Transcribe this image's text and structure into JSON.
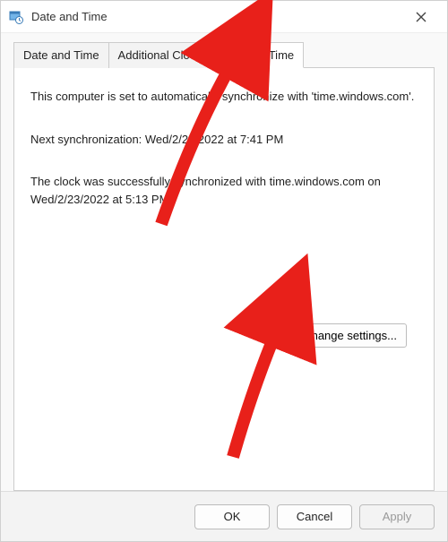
{
  "window": {
    "title": "Date and Time"
  },
  "tabs": {
    "0": {
      "label": "Date and Time"
    },
    "1": {
      "label": "Additional Clocks"
    },
    "2": {
      "label": "Internet Time"
    }
  },
  "content": {
    "sync_info": "This computer is set to automatically synchronize with 'time.windows.com'.",
    "next_sync": "Next synchronization: Wed/2/23/2022 at 7:41 PM",
    "last_sync": "The clock was successfully synchronized with time.windows.com on Wed/2/23/2022 at 5:13 PM.",
    "change_button": "Change settings..."
  },
  "footer": {
    "ok": "OK",
    "cancel": "Cancel",
    "apply": "Apply"
  },
  "colors": {
    "arrow": "#E8201A"
  }
}
